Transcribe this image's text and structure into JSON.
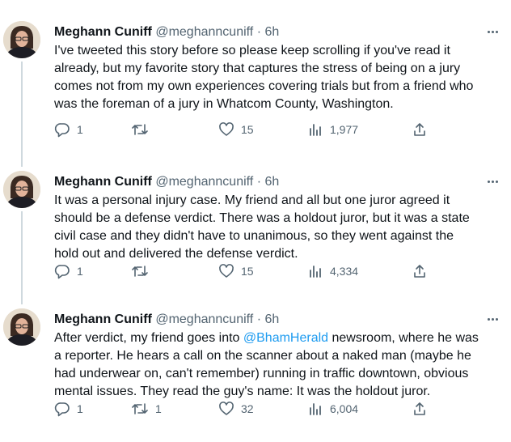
{
  "tweets": [
    {
      "name": "Meghann Cuniff",
      "handle": "@meghanncuniff",
      "dot": "·",
      "time": "6h",
      "text_lines": [
        "I've tweeted this story before so please keep scrolling if you've read it",
        "already, but my favorite story that captures the stress of being on a jury",
        "comes not from my own experiences covering trials but from a friend who",
        "was the foreman of a jury in Whatcom County, Washington."
      ],
      "replies": "1",
      "retweets": "",
      "likes": "15",
      "views": "1,977"
    },
    {
      "name": "Meghann Cuniff",
      "handle": "@meghanncuniff",
      "dot": "·",
      "time": "6h",
      "text_lines": [
        "It was a personal injury case. My friend and all but one juror agreed it",
        "should be a defense verdict. There was a holdout juror, but it was a state",
        "civil case and they didn't have to unanimous, so they went against the",
        "hold out and delivered the defense verdict."
      ],
      "replies": "1",
      "retweets": "",
      "likes": "15",
      "views": "4,334"
    },
    {
      "name": "Meghann Cuniff",
      "handle": "@meghanncuniff",
      "dot": "·",
      "time": "6h",
      "text_line1_before": "After verdict, my friend goes into ",
      "text_line1_mention": "@BhamHerald",
      "text_line1_after": " newsroom, where he was",
      "text_lines": [
        "a reporter. He hears a call on the scanner about a naked man (maybe he",
        "had underwear on, can't remember) running in traffic downtown, obvious",
        "mental issues. They read the guy's name: It was the holdout juror."
      ],
      "replies": "1",
      "retweets": "1",
      "likes": "32",
      "views": "6,004"
    }
  ],
  "colors": {
    "text": "#0f1419",
    "secondary": "#536471",
    "link": "#1d9bf0",
    "thread_line": "#cfd9de"
  },
  "icons": [
    "reply-icon",
    "retweet-icon",
    "like-icon",
    "views-icon",
    "share-icon",
    "more-icon"
  ]
}
